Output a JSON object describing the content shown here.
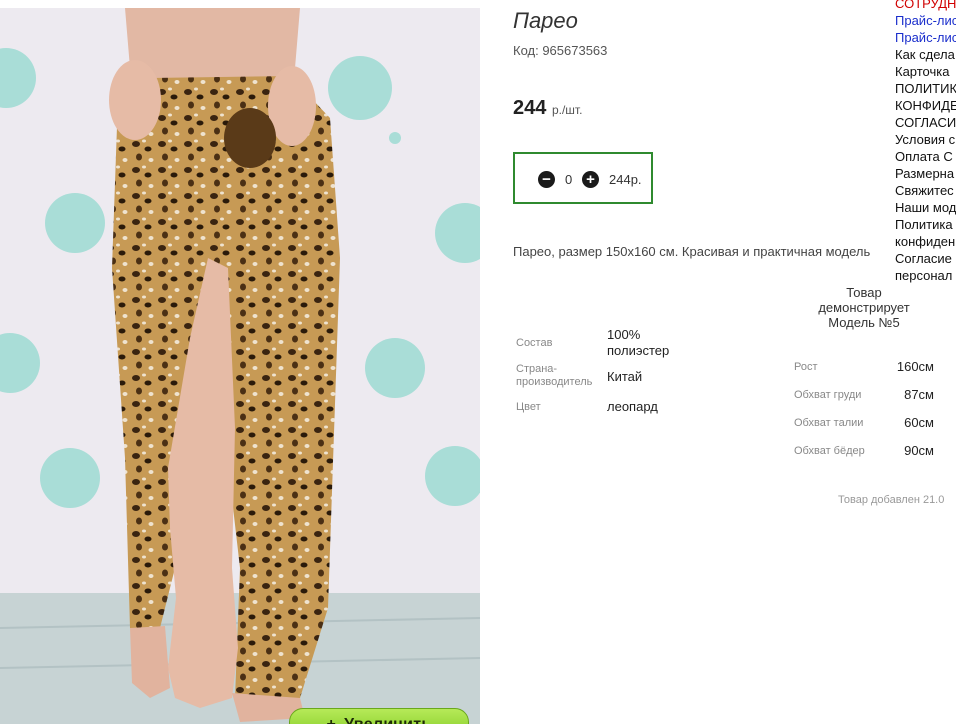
{
  "product": {
    "title": "Парео",
    "code": "Код: 965673563",
    "price": "244",
    "price_unit": "р./шт.",
    "quantity": "0",
    "sum": "244р.",
    "description": "Парео, размер 150х160 см. Красивая и практичная модель",
    "zoom_label": "Увеличить",
    "added": "Товар добавлен 21.0",
    "specs": [
      {
        "label": "Состав",
        "value": "100% полиэстер"
      },
      {
        "label": "Страна-производитель",
        "value": "Китай"
      },
      {
        "label": "Цвет",
        "value": "леопард"
      }
    ]
  },
  "model": {
    "heading": "Товар демонстрирует Модель №5",
    "params": [
      {
        "label": "Рост",
        "value": "160см"
      },
      {
        "label": "Обхват груди",
        "value": "87см"
      },
      {
        "label": "Обхват талии",
        "value": "60см"
      },
      {
        "label": "Обхват бёдер",
        "value": "90см"
      }
    ]
  },
  "side_menu": [
    {
      "label": "СОТРУДН",
      "color": "#d00000"
    },
    {
      "label": "Прайс-лис",
      "color": "#1a2ecc"
    },
    {
      "label": "Прайс-лис",
      "color": "#1a2ecc"
    },
    {
      "label": "Как сдела",
      "color": "#111111"
    },
    {
      "label": "Карточка",
      "color": "#111111"
    },
    {
      "label": "ПОЛИТИК",
      "color": "#111111"
    },
    {
      "label": "КОНФИДЕ",
      "color": "#111111"
    },
    {
      "label": "СОГЛАСИ",
      "color": "#111111"
    },
    {
      "label": "Условия с",
      "color": "#111111"
    },
    {
      "label": "Оплата С",
      "color": "#111111"
    },
    {
      "label": "Размерна",
      "color": "#111111"
    },
    {
      "label": "Свяжитес",
      "color": "#111111"
    },
    {
      "label": "Наши мод",
      "color": "#111111"
    },
    {
      "label": "Политика",
      "color": "#111111"
    },
    {
      "label": "конфиден",
      "color": "#111111"
    },
    {
      "label": "Согласие",
      "color": "#111111"
    },
    {
      "label": "персонал",
      "color": "#111111"
    }
  ]
}
